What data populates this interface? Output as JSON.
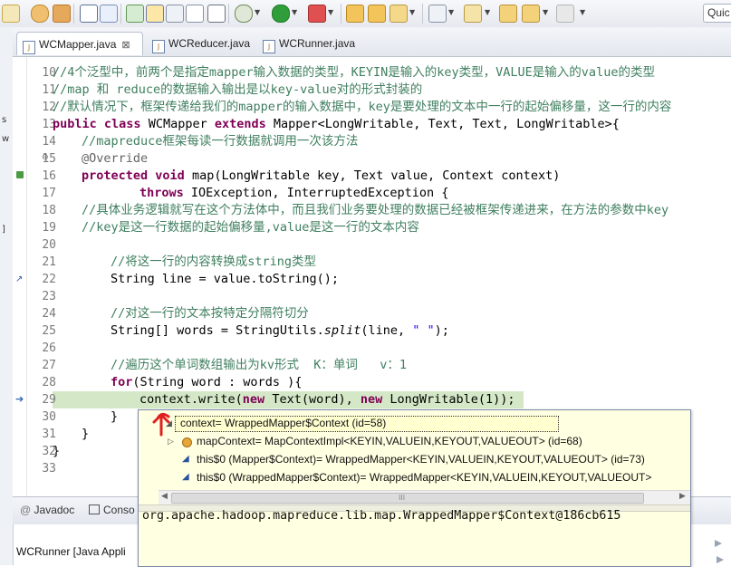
{
  "toolbar": {
    "quick_access": "Quic"
  },
  "left_strip": {
    "glyphs": [
      "s",
      "w",
      "]"
    ]
  },
  "editor_tabs": [
    {
      "label": "WCMapper.java",
      "close": "⊠",
      "active": true
    },
    {
      "label": "WCReducer.java",
      "active": false
    },
    {
      "label": "WCRunner.java",
      "active": false
    }
  ],
  "code": {
    "line_numbers": [
      "10",
      "11",
      "12",
      "13",
      "14",
      "15",
      "16",
      "17",
      "18",
      "19",
      "20",
      "21",
      "22",
      "23",
      "24",
      "25",
      "26",
      "27",
      "28",
      "29",
      "30",
      "31",
      "32",
      "33"
    ],
    "l10": "//4个泛型中，前两个是指定mapper输入数据的类型，KEYIN是输入的key类型，VALUE是输入的value的类型",
    "l11": "//map 和 reduce的数据输入输出是以key-value对的形式封装的",
    "l12": "//默认情况下，框架传递给我们的mapper的输入数据中，key是要处理的文本中一行的起始偏移量，这一行的内容",
    "l13_kw1": "public",
    "l13_kw2": "class",
    "l13_a": " WCMapper ",
    "l13_kw3": "extends",
    "l13_b": " Mapper<LongWritable, Text, Text, LongWritable>{",
    "l14": "//mapreduce框架每读一行数据就调用一次该方法",
    "l15": "@Override",
    "l16_kw1": "protected",
    "l16_kw2": "void",
    "l16_rest": " map(LongWritable key, Text value, Context context)",
    "l17_kw": "throws",
    "l17_rest": " IOException, InterruptedException {",
    "l18": "//具体业务逻辑就写在这个方法体中，而且我们业务要处理的数据已经被框架传递进来，在方法的参数中key",
    "l19": "//key是这一行数据的起始偏移量,value是这一行的文本内容",
    "l21": "//将这一行的内容转换成string类型",
    "l22": "String line = value.toString();",
    "l24": "//对这一行的文本按特定分隔符切分",
    "l25_a": "String[] words = StringUtils.",
    "l25_m": "split",
    "l25_b": "(line, ",
    "l25_s": "\" \"",
    "l25_c": ");",
    "l27": "//遍历这个单词数组输出为kv形式  K：单词   v：1",
    "l28_kw": "for",
    "l28_rest": "(String word : words ){",
    "l29_a": "context.write(",
    "l29_kw1": "new",
    "l29_b": " Text(word), ",
    "l29_kw2": "new",
    "l29_c": " LongWritable(1));",
    "l30": "}",
    "l31": "}",
    "l32": "}"
  },
  "popup": {
    "rows": [
      "context= WrappedMapper$Context  (id=58)",
      "mapContext= MapContextImpl<KEYIN,VALUEIN,KEYOUT,VALUEOUT>  (id=68)",
      "this$0 (Mapper$Context)= WrappedMapper<KEYIN,VALUEIN,KEYOUT,VALUEOUT>  (id=73)",
      "this$0 (WrappedMapper$Context)= WrappedMapper<KEYIN,VALUEIN,KEYOUT,VALUEOUT>"
    ],
    "grip": "III",
    "detail": "org.apache.hadoop.mapreduce.lib.map.WrappedMapper$Context@186cb615"
  },
  "bottom": {
    "tabs": [
      "Javadoc",
      "Conso"
    ],
    "console_title": "WCRunner [Java Appli"
  },
  "colors": {
    "comment": "#3f7f5f",
    "keyword": "#7f0055",
    "field": "#0000c0",
    "string": "#2a00ff",
    "current_line": "#d4e8c7",
    "popup_bg": "#ffffe1"
  }
}
